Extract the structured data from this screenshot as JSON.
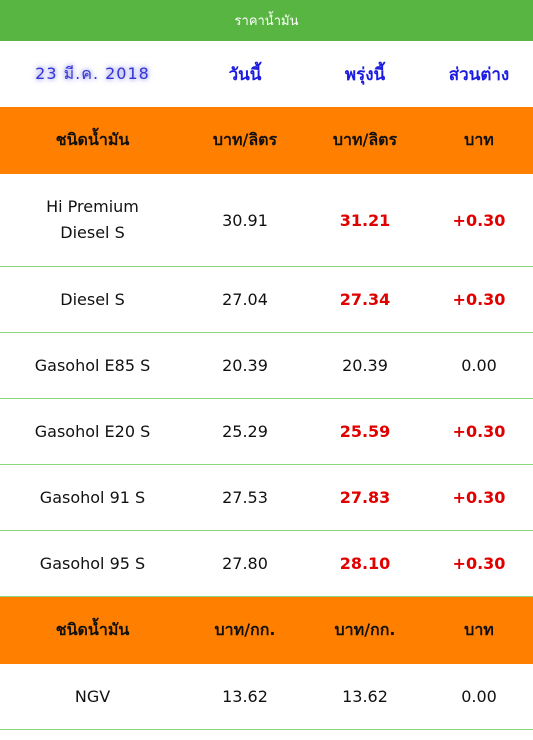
{
  "header": {
    "title": "ราคาน้ำมัน"
  },
  "date_row": {
    "date": "23 มี.ค. 2018",
    "today": "วันนี้",
    "tomorrow": "พรุ่งนี้",
    "diff": "ส่วนต่าง"
  },
  "section1": {
    "col_type": "ชนิดน้ำมัน",
    "col_today": "บาท/ลิตร",
    "col_tomorrow": "บาท/ลิตร",
    "col_diff": "บาท"
  },
  "fuels": [
    {
      "name": "Hi Premium Diesel S",
      "today": "30.91",
      "tomorrow": "31.21",
      "diff": "+0.30",
      "changed": true
    },
    {
      "name": "Diesel S",
      "today": "27.04",
      "tomorrow": "27.34",
      "diff": "+0.30",
      "changed": true
    },
    {
      "name": "Gasohol E85 S",
      "today": "20.39",
      "tomorrow": "20.39",
      "diff": "0.00",
      "changed": false
    },
    {
      "name": "Gasohol E20 S",
      "today": "25.29",
      "tomorrow": "25.59",
      "diff": "+0.30",
      "changed": true
    },
    {
      "name": "Gasohol 91 S",
      "today": "27.53",
      "tomorrow": "27.83",
      "diff": "+0.30",
      "changed": true
    },
    {
      "name": "Gasohol 95 S",
      "today": "27.80",
      "tomorrow": "28.10",
      "diff": "+0.30",
      "changed": true
    }
  ],
  "section2": {
    "col_type": "ชนิดน้ำมัน",
    "col_today": "บาท/กก.",
    "col_tomorrow": "บาท/กก.",
    "col_diff": "บาท"
  },
  "gas": [
    {
      "name": "NGV",
      "today": "13.62",
      "tomorrow": "13.62",
      "diff": "0.00",
      "changed": false
    }
  ],
  "colors": {
    "topbar": "#59b541",
    "section_header": "#ff7f00",
    "increase": "#e00000",
    "header_text": "#1c1ce0",
    "row_divider": "#8bd87a"
  }
}
